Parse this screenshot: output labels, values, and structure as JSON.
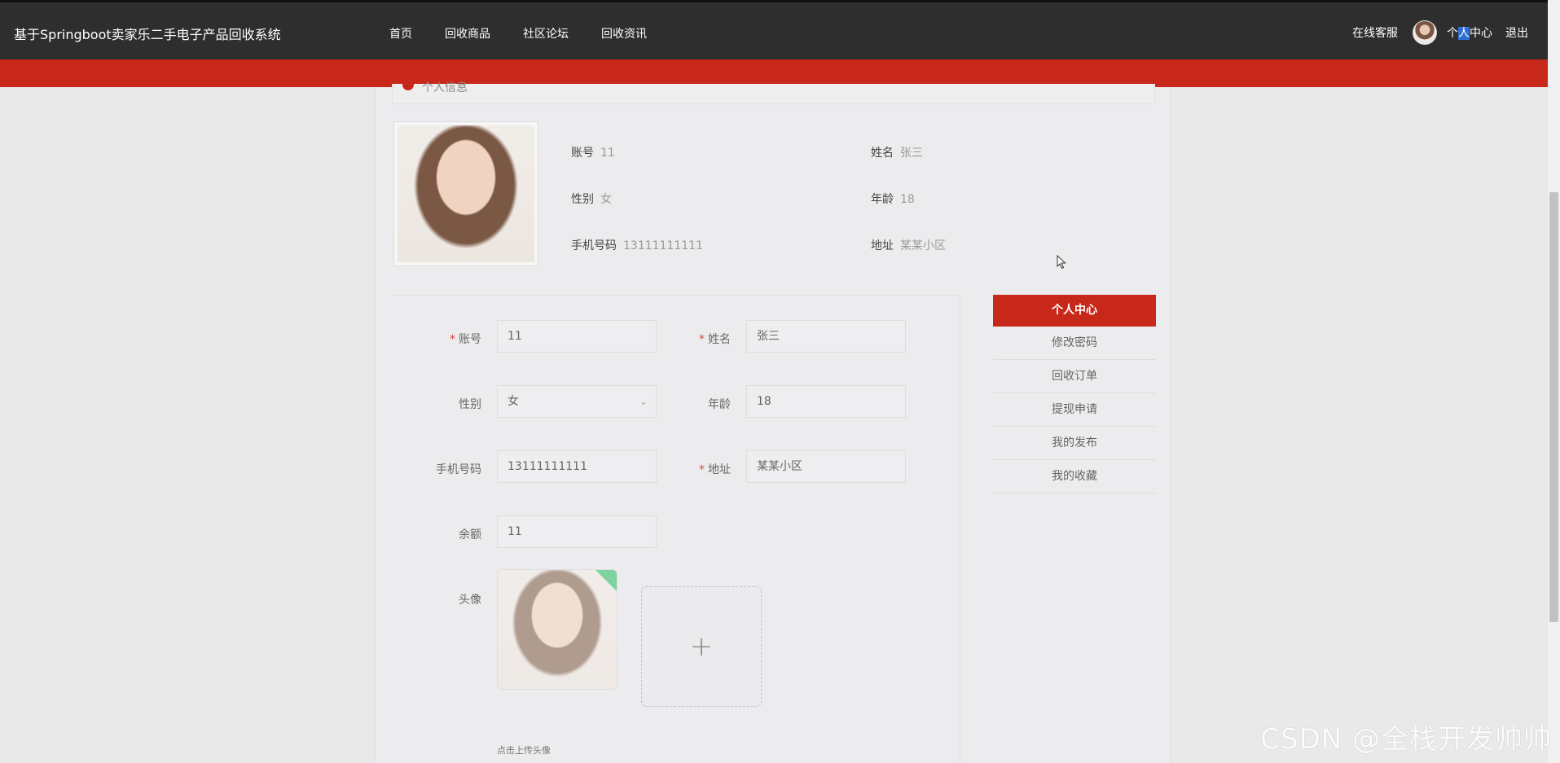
{
  "header": {
    "brand": "基于Springboot卖家乐二手电子产品回收系统",
    "nav": [
      "首页",
      "回收商品",
      "社区论坛",
      "回收资讯"
    ],
    "online_service": "在线客服",
    "user_center_a": "个",
    "user_center_b": "人",
    "user_center_c": "中心",
    "logout": "退出"
  },
  "section": {
    "title": "个人信息"
  },
  "profile": {
    "account_label": "账号",
    "account": "11",
    "name_label": "姓名",
    "name": "张三",
    "gender_label": "性别",
    "gender": "女",
    "age_label": "年龄",
    "age": "18",
    "phone_label": "手机号码",
    "phone": "13111111111",
    "address_label": "地址",
    "address": "某某小区"
  },
  "form": {
    "account_label": "账号",
    "account": "11",
    "name_label": "姓名",
    "name": "张三",
    "gender_label": "性别",
    "gender": "女",
    "age_label": "年龄",
    "age": "18",
    "phone_label": "手机号码",
    "phone": "13111111111",
    "address_label": "地址",
    "address": "某某小区",
    "balance_label": "余额",
    "balance": "11",
    "avatar_label": "头像",
    "upload_tip": "点击上传头像",
    "required_mark": "*"
  },
  "side_menu": [
    "个人中心",
    "修改密码",
    "回收订单",
    "提现申请",
    "我的发布",
    "我的收藏"
  ],
  "watermark": "CSDN @全栈开发帅帅",
  "colors": {
    "accent": "#c8281a",
    "topbar": "#2e2e2e"
  }
}
